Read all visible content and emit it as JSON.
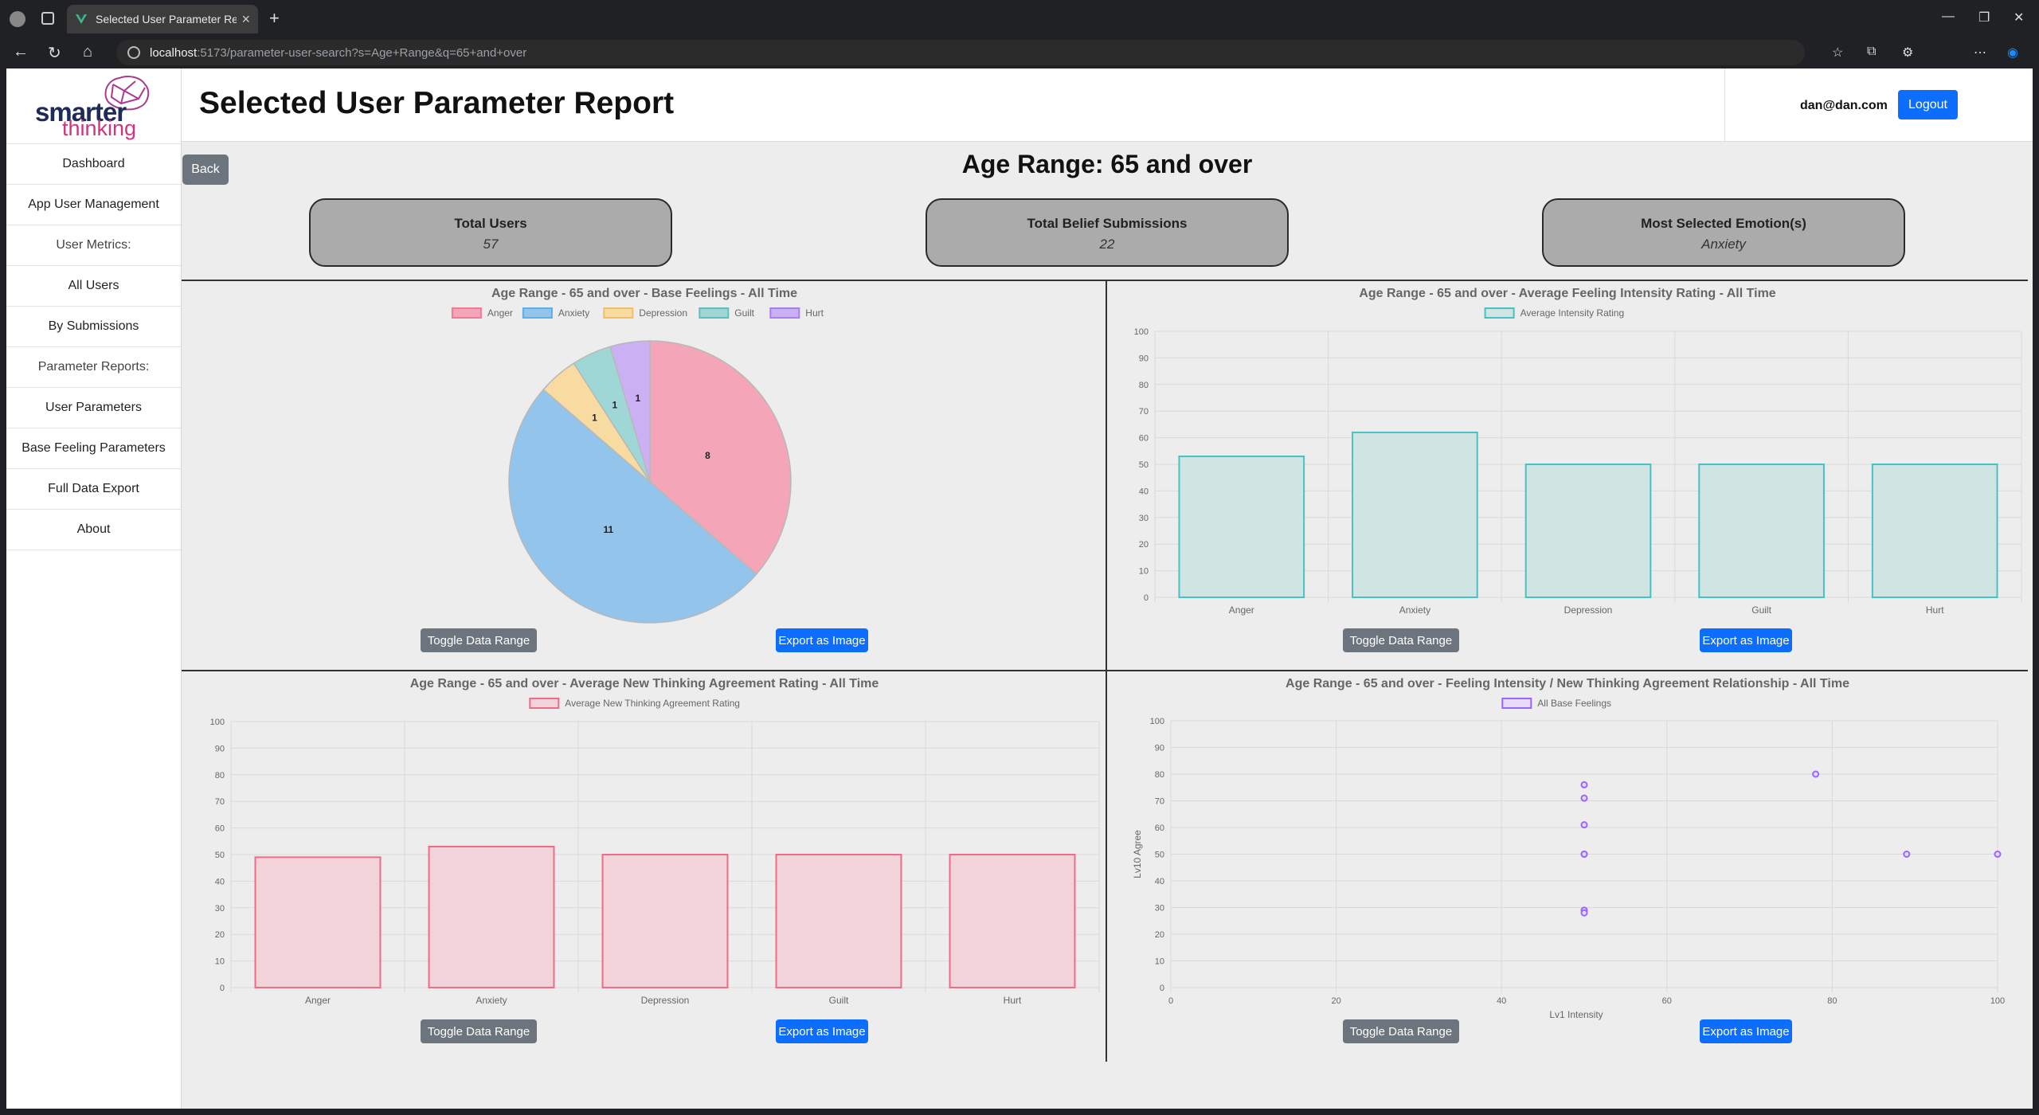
{
  "browser": {
    "tab_title": "Selected User Parameter Report",
    "url_host": "localhost",
    "url_path": ":5173/parameter-user-search?s=Age+Range&q=65+and+over"
  },
  "logo": {
    "word1": "smarter",
    "word2": "thinking"
  },
  "sidebar": {
    "items": [
      {
        "label": "Dashboard"
      },
      {
        "label": "App User Management"
      },
      {
        "label": "User Metrics:"
      },
      {
        "label": "All Users"
      },
      {
        "label": "By Submissions"
      },
      {
        "label": "Parameter Reports:"
      },
      {
        "label": "User Parameters"
      },
      {
        "label": "Base Feeling Parameters"
      },
      {
        "label": "Full Data Export"
      },
      {
        "label": "About"
      }
    ]
  },
  "header": {
    "title": "Selected User Parameter Report",
    "user_email": "dan@dan.com",
    "logout_label": "Logout"
  },
  "back_label": "Back",
  "section_title": "Age Range: 65 and over",
  "stats": [
    {
      "label": "Total Users",
      "value": "57"
    },
    {
      "label": "Total Belief Submissions",
      "value": "22"
    },
    {
      "label": "Most Selected Emotion(s)",
      "value": "Anxiety"
    }
  ],
  "buttons": {
    "toggle": "Toggle Data Range",
    "export": "Export as Image"
  },
  "colors": {
    "anger": "#f4a6b8",
    "anxiety": "#92c4ec",
    "depression": "#f8dba0",
    "guilt": "#9fd6d6",
    "hurt": "#cbb0f4",
    "teal_fill": "#cfe5e4",
    "teal_stroke": "#4bc0c0",
    "pink_fill": "#f2d3d9",
    "pink_stroke": "#f06b87",
    "purple": "#9966ff"
  },
  "chart_data": [
    {
      "type": "pie",
      "title": "Age Range - 65 and over - Base Feelings - All Time",
      "categories": [
        "Anger",
        "Anxiety",
        "Depression",
        "Guilt",
        "Hurt"
      ],
      "values": [
        8,
        11,
        1,
        1,
        1
      ],
      "legend": "top"
    },
    {
      "type": "bar",
      "title": "Age Range - 65 and over - Average Feeling Intensity Rating  - All Time",
      "categories": [
        "Anger",
        "Anxiety",
        "Depression",
        "Guilt",
        "Hurt"
      ],
      "series": [
        {
          "name": "Average Intensity Rating",
          "values": [
            53,
            62,
            50,
            50,
            50
          ]
        }
      ],
      "ylim": [
        0,
        100
      ],
      "yticks": [
        0,
        10,
        20,
        30,
        40,
        50,
        60,
        70,
        80,
        90,
        100
      ],
      "grid": true,
      "legend": "top"
    },
    {
      "type": "bar",
      "title": "Age Range - 65 and over - Average New Thinking Agreement Rating  - All Time",
      "categories": [
        "Anger",
        "Anxiety",
        "Depression",
        "Guilt",
        "Hurt"
      ],
      "series": [
        {
          "name": "Average New Thinking Agreement Rating",
          "values": [
            49,
            53,
            50,
            50,
            50
          ]
        }
      ],
      "ylim": [
        0,
        100
      ],
      "yticks": [
        0,
        10,
        20,
        30,
        40,
        50,
        60,
        70,
        80,
        90,
        100
      ],
      "grid": true,
      "legend": "top"
    },
    {
      "type": "scatter",
      "title": "Age Range - 65 and over - Feeling Intensity / New Thinking Agreement Relationship  - All Time",
      "xlabel": "Lv1 Intensity",
      "ylabel": "Lv10 Agree",
      "series": [
        {
          "name": "All Base Feelings",
          "points": [
            [
              50,
              76
            ],
            [
              50,
              71
            ],
            [
              50,
              61
            ],
            [
              50,
              50
            ],
            [
              50,
              50
            ],
            [
              50,
              29
            ],
            [
              50,
              28
            ],
            [
              78,
              80
            ],
            [
              89,
              50
            ],
            [
              100,
              50
            ]
          ]
        }
      ],
      "xlim": [
        0,
        100
      ],
      "ylim": [
        0,
        100
      ],
      "xticks": [
        0,
        20,
        40,
        60,
        80,
        100
      ],
      "yticks": [
        0,
        10,
        20,
        30,
        40,
        50,
        60,
        70,
        80,
        90,
        100
      ],
      "grid": true,
      "legend": "top"
    }
  ]
}
